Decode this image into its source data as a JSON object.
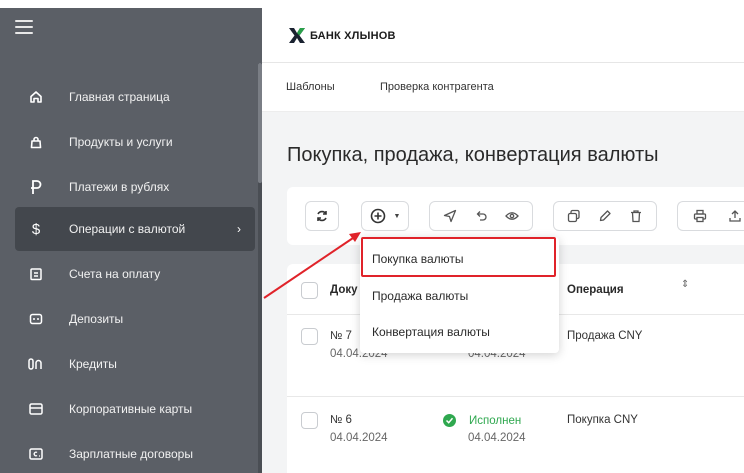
{
  "sidebar": {
    "items": [
      {
        "label": "Главная страница",
        "icon": "home-icon"
      },
      {
        "label": "Продукты и услуги",
        "icon": "bag-icon"
      },
      {
        "label": "Платежи в рублях",
        "icon": "ruble-icon"
      },
      {
        "label": "Операции с валютой",
        "icon": "dollar-icon",
        "active": true
      },
      {
        "label": "Счета на оплату",
        "icon": "invoice-icon"
      },
      {
        "label": "Депозиты",
        "icon": "deposit-icon"
      },
      {
        "label": "Кредиты",
        "icon": "credit-icon"
      },
      {
        "label": "Корпоративные карты",
        "icon": "card-icon"
      },
      {
        "label": "Зарплатные договоры",
        "icon": "salary-icon"
      }
    ]
  },
  "header": {
    "brand": "БАНК ХЛЫНОВ"
  },
  "subnav": {
    "templates": "Шаблоны",
    "counterparty_check": "Проверка контрагента"
  },
  "main": {
    "title": "Покупка, продажа, конвертация валюты"
  },
  "table": {
    "headers": {
      "document": "Доку",
      "operation": "Операция"
    },
    "rows": [
      {
        "number": "№ 7",
        "date": "04.04.2024",
        "status_date": "04.04.2024",
        "operation": "Продажа CNY"
      },
      {
        "number": "№ 6",
        "date": "04.04.2024",
        "status": "Исполнен",
        "status_date": "04.04.2024",
        "operation": "Покупка CNY"
      }
    ]
  },
  "dropdown": {
    "items": [
      "Покупка валюты",
      "Продажа валюты",
      "Конвертация валюты"
    ]
  },
  "colors": {
    "sidebar": "#5b5f66",
    "highlight": "#e0232a",
    "success": "#2fa84f"
  }
}
